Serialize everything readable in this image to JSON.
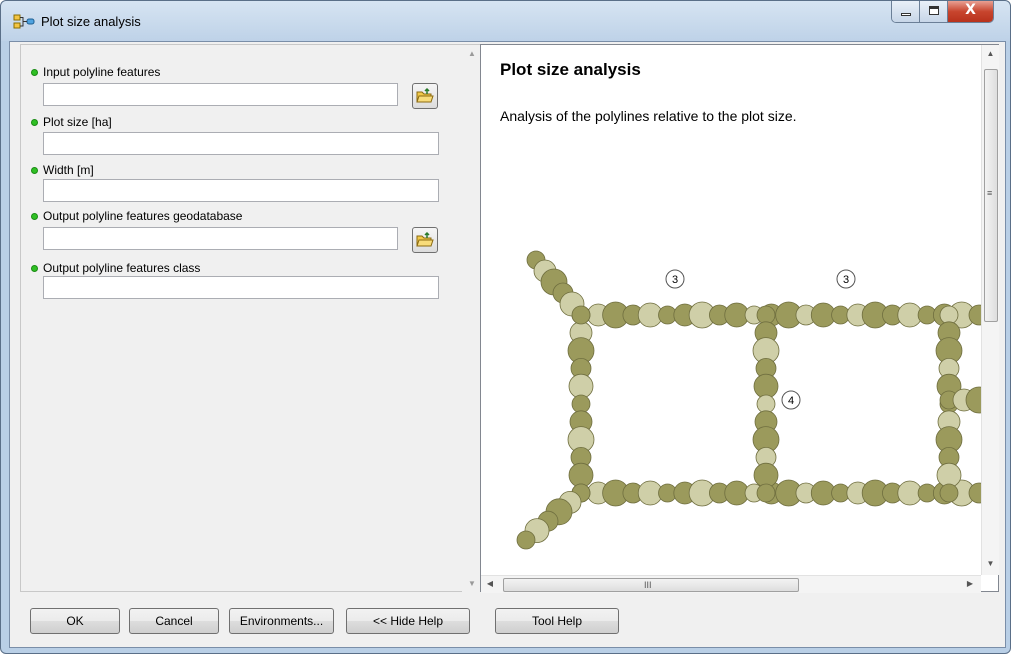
{
  "window": {
    "title": "Plot size analysis",
    "controls": {
      "minimize": "minimize",
      "maximize": "maximize",
      "close": "X"
    }
  },
  "params": [
    {
      "label": "Input polyline features",
      "value": "",
      "has_browse": true
    },
    {
      "label": "Plot size [ha]",
      "value": "",
      "has_browse": false
    },
    {
      "label": "Width [m]",
      "value": "",
      "has_browse": false
    },
    {
      "label": "Output polyline features geodatabase",
      "value": "",
      "has_browse": true
    },
    {
      "label": "Output polyline features class",
      "value": "",
      "has_browse": false
    }
  ],
  "help": {
    "title": "Plot size analysis",
    "description": "Analysis of the polylines relative to the plot size.",
    "labels": [
      "3",
      "3",
      "4"
    ],
    "hscroll_grip": "III",
    "vscroll_grip": "≡"
  },
  "buttons": {
    "ok": "OK",
    "cancel": "Cancel",
    "environments": "Environments...",
    "hide_help": "<< Hide Help",
    "tool_help": "Tool Help"
  },
  "colors": {
    "required_dot": "#2fbf24",
    "tree_dark": "#9b9a5c",
    "tree_light": "#cfcfa8",
    "title_gradient_top": "#d6e4f2",
    "close_red": "#c8452e"
  }
}
